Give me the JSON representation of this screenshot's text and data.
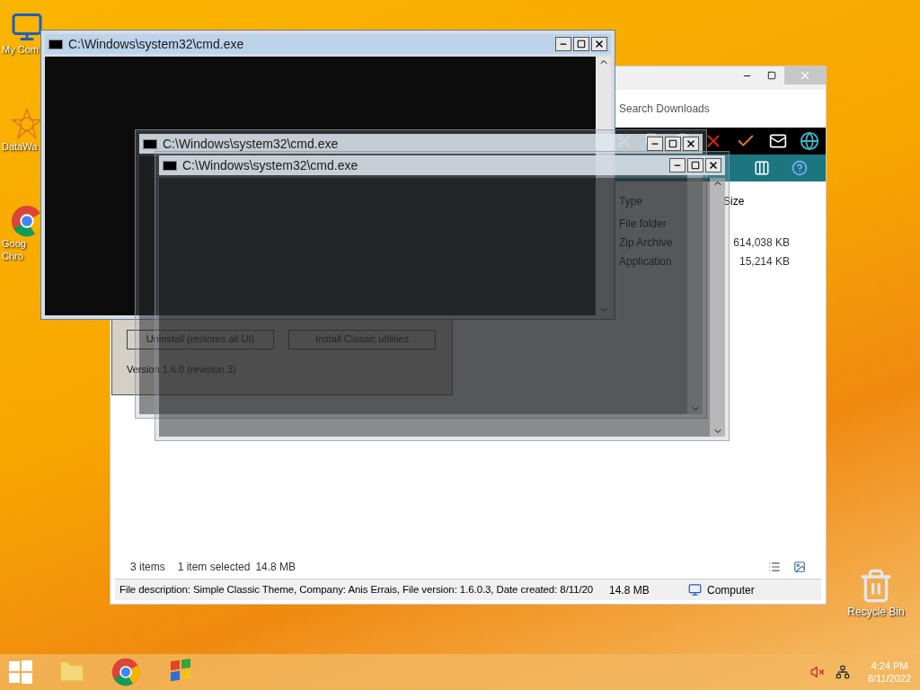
{
  "desktop_icons": [
    {
      "kind": "computer",
      "lines": [
        "My Com"
      ]
    },
    {
      "kind": "app",
      "lines": [
        "DataWa"
      ]
    },
    {
      "kind": "browser",
      "lines": [
        "Goog",
        "Chro"
      ]
    }
  ],
  "recycle_bin": {
    "label": "Recycle Bin"
  },
  "explorer": {
    "search": {
      "placeholder": "Search Downloads"
    },
    "columns": [
      "Type",
      "Size"
    ],
    "rows": [
      {
        "type": "File folder"
      },
      {
        "type": "Zip Archive",
        "size": "614,038 KB"
      },
      {
        "type": "Application",
        "size": "15,214 KB"
      }
    ],
    "status_bar": {
      "count": "3 items",
      "selection": "1 item selected",
      "size": "14.8 MB"
    },
    "details_bar": {
      "description": "File description: Simple Classic Theme, Company: Anis Errais, File version: 1.6.0.3, Date created: 8/11/20",
      "size": "14.8 MB",
      "location": "Computer"
    }
  },
  "classic_dialog": {
    "buttons": [
      "Uninstall (restores all UI)",
      "Install Classic utilities"
    ],
    "version": "Version 1.6.0 (revision 3)"
  },
  "cmd_windows": [
    {
      "title": "C:\\Windows\\system32\\cmd.exe",
      "ghost": false
    },
    {
      "title": "C:\\Windows\\system32\\cmd.exe",
      "ghost": true
    },
    {
      "title": "C:\\Windows\\system32\\cmd.exe",
      "ghost": true
    }
  ],
  "taskbar": {
    "apps": [
      {
        "kind": "explorer"
      },
      {
        "kind": "chrome"
      },
      {
        "kind": "classic"
      }
    ],
    "volume_muted": true,
    "time": "4:24 PM",
    "date": "8/11/2022"
  }
}
